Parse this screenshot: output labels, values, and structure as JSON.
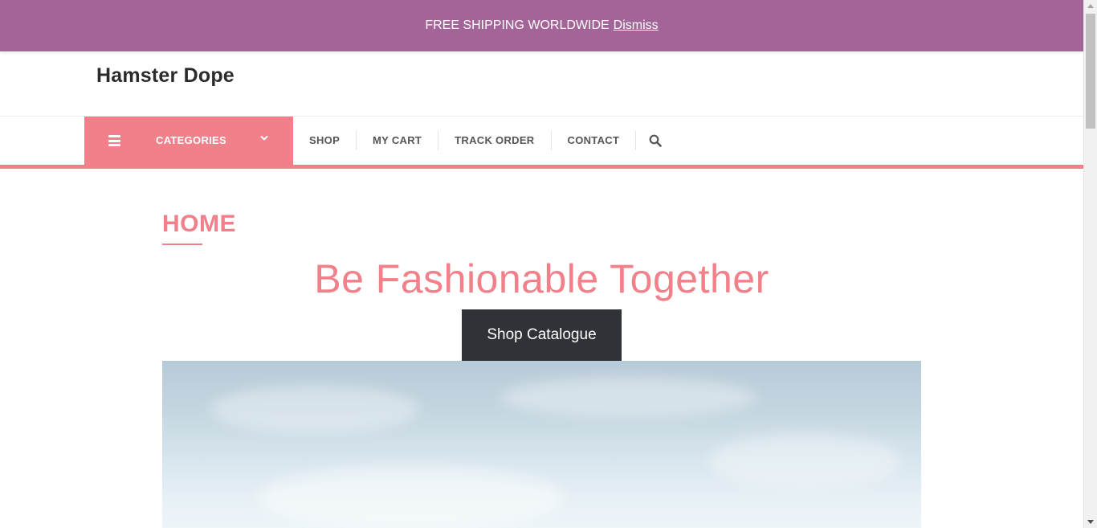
{
  "notice": {
    "text": "FREE SHIPPING WORLDWIDE",
    "dismiss_label": "Dismiss"
  },
  "header": {
    "site_title": "Hamster Dope"
  },
  "nav": {
    "categories_label": "CATEGORIES",
    "items": [
      {
        "label": "SHOP"
      },
      {
        "label": "MY CART"
      },
      {
        "label": "TRACK ORDER"
      },
      {
        "label": "CONTACT"
      }
    ],
    "search_icon": "search-icon"
  },
  "main": {
    "page_title": "HOME",
    "hero_heading": "Be Fashionable Together",
    "cta_label": "Shop Catalogue"
  },
  "colors": {
    "notice_bg": "#a36597",
    "accent": "#f1808a",
    "button_bg": "#2f3337"
  }
}
